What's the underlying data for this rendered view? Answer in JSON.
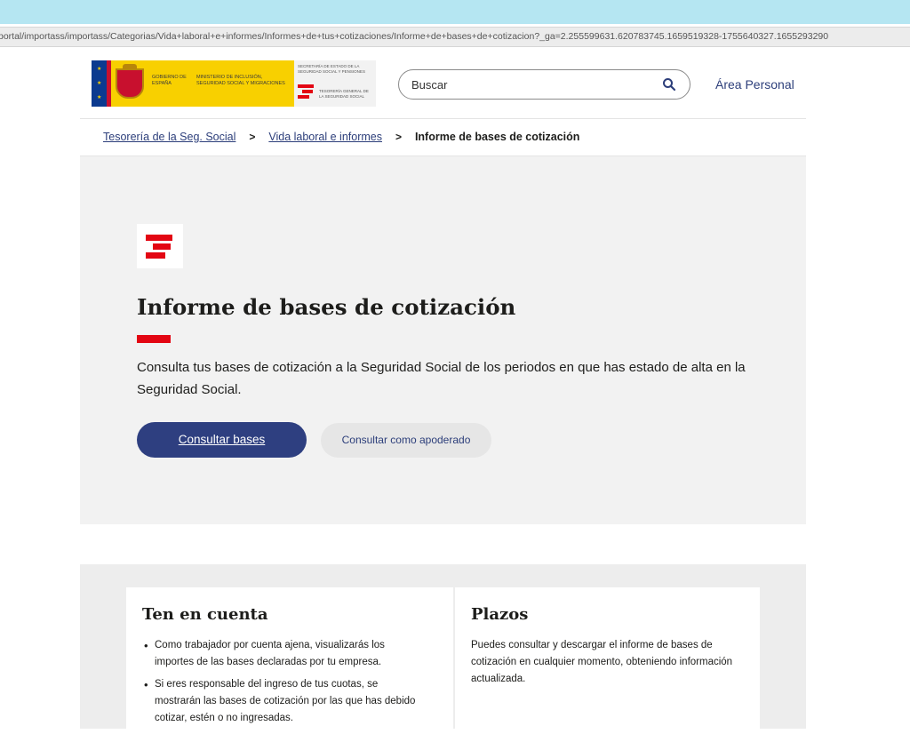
{
  "browser": {
    "url": "portal/importass/importass/Categorias/Vida+laboral+e+informes/Informes+de+tus+cotizaciones/Informe+de+bases+de+cotizacion?_ga=2.255599631.620783745.1659519328-1755640327.1655293290"
  },
  "header": {
    "gov_label": "GOBIERNO DE ESPAÑA",
    "ministry_label": "MINISTERIO DE INCLUSIÓN, SEGURIDAD SOCIAL Y MIGRACIONES",
    "secretaria_label": "SECRETARÍA DE ESTADO DE LA SEGURIDAD SOCIAL Y PENSIONES",
    "tgss_label": "TESORERÍA GENERAL DE LA SEGURIDAD SOCIAL",
    "search_placeholder": "Buscar",
    "area_personal": "Área Personal"
  },
  "breadcrumb": {
    "items": [
      {
        "label": "Tesorería de la Seg. Social"
      },
      {
        "label": "Vida laboral e informes"
      }
    ],
    "separator": ">",
    "current": "Informe de bases de cotización"
  },
  "hero": {
    "title": "Informe de bases de cotización",
    "description": "Consulta tus bases de cotización a la Seguridad Social de los periodos en que has estado de alta en la Seguridad Social.",
    "primary_button": "Consultar bases",
    "secondary_button": "Consultar como apoderado"
  },
  "info": {
    "left": {
      "title": "Ten en cuenta",
      "items": [
        "Como trabajador por cuenta ajena, visualizarás los importes de las bases declaradas por tu empresa.",
        "Si eres responsable del ingreso de tus cuotas, se mostrarán las bases de cotización por las que has debido cotizar, estén o no ingresadas."
      ]
    },
    "right": {
      "title": "Plazos",
      "text": "Puedes consultar y descargar el informe de bases de cotización en cualquier momento, obteniendo información actualizada."
    }
  },
  "colors": {
    "brand_blue": "#2e3f80",
    "brand_red": "#e30613",
    "link": "#2c3e7a"
  }
}
